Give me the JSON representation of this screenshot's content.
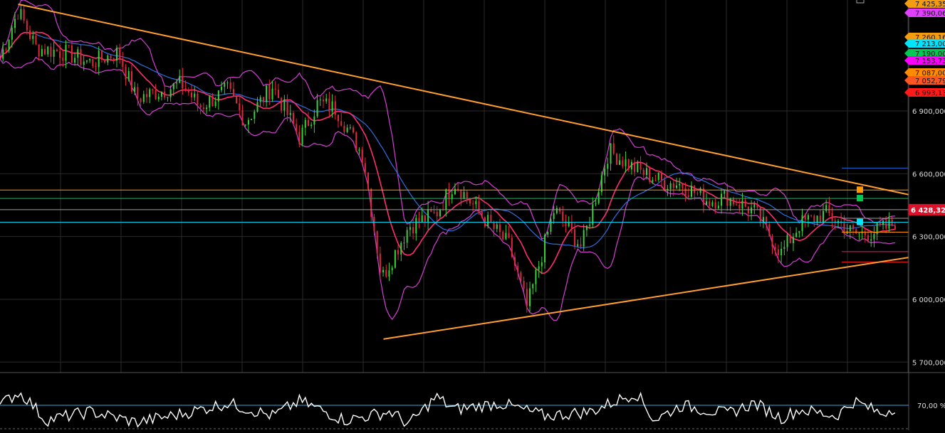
{
  "chart_data": [
    {
      "type": "candlestick",
      "title": "",
      "xlabel": "",
      "ylabel": "",
      "ylim": [
        5650000,
        7430000
      ],
      "grid": true,
      "y_tick_labels": [
        "6 900,000",
        "6 600,000",
        "6 300,000",
        "6 000,000",
        "5 700,000"
      ],
      "y_tick_values": [
        6900000,
        6600000,
        6300000,
        6000000,
        5700000
      ],
      "current_price_label": "6 428,320",
      "current_price": 6428320,
      "price_tags": [
        {
          "label": "7 425,356",
          "value": 7425356,
          "color": "#f39c12"
        },
        {
          "label": "7 390,06",
          "value": 7390060,
          "color": "#e040fb"
        },
        {
          "label": "7 260,160",
          "value": 7260160,
          "color": "#f39c12"
        },
        {
          "label": "7 213,00",
          "value": 7213000,
          "color": "#00e5ff"
        },
        {
          "label": "7 190,00",
          "value": 7190000,
          "color": "#00c853"
        },
        {
          "label": "7 153,73",
          "value": 7153730,
          "color": "#ff00ff"
        },
        {
          "label": "7 087,00",
          "value": 7087000,
          "color": "#ff8c00"
        },
        {
          "label": "7 052,79",
          "value": 7052790,
          "color": "#ff5722"
        },
        {
          "label": "6 993,13",
          "value": 6993130,
          "color": "#ff1a1a"
        }
      ],
      "horizontal_levels": [
        {
          "value": 6522000,
          "color": "#ff9800",
          "marker": true
        },
        {
          "value": 6482000,
          "color": "#00c853",
          "marker": true
        },
        {
          "value": 6428320,
          "color": "#9e9e9e",
          "marker": false
        },
        {
          "value": 6368000,
          "color": "#00e5ff",
          "marker": true
        },
        {
          "value": 6627000,
          "color": "#1e6bd6",
          "marker": false
        },
        {
          "value": 6387000,
          "color": "#9e9e9e",
          "marker": false
        },
        {
          "value": 6321000,
          "color": "#ff9800",
          "marker": false
        },
        {
          "value": 6228000,
          "color": "#e91e63",
          "marker": false
        },
        {
          "value": 6178000,
          "color": "#ff1a1a",
          "marker": false
        }
      ],
      "trendlines": [
        {
          "name": "",
          "from": [
            0.02,
            7410000
          ],
          "to": [
            1.0,
            6500000
          ],
          "color": "#ff9d2e"
        },
        {
          "name": "",
          "from": [
            0.422,
            5810000
          ],
          "to": [
            1.0,
            6200000
          ],
          "color": "#ff9d2e"
        }
      ],
      "series": [
        {
          "name": "",
          "kind": "close",
          "x": [
            0,
            0.02,
            0.04,
            0.07,
            0.1,
            0.13,
            0.15,
            0.18,
            0.2,
            0.22,
            0.25,
            0.27,
            0.3,
            0.33,
            0.35,
            0.37,
            0.4,
            0.42,
            0.45,
            0.48,
            0.5,
            0.53,
            0.56,
            0.58,
            0.61,
            0.64,
            0.67,
            0.7,
            0.73,
            0.75,
            0.78,
            0.8,
            0.83,
            0.86,
            0.88,
            0.91,
            0.94,
            0.96,
            0.98,
            1.0
          ],
          "values": [
            7150000,
            7380000,
            7200000,
            7180000,
            7130000,
            7180000,
            6960000,
            7000000,
            7030000,
            6920000,
            7000000,
            6850000,
            7020000,
            6770000,
            6940000,
            6910000,
            6680000,
            6100000,
            6350000,
            6410000,
            6560000,
            6400000,
            6260000,
            5960000,
            6430000,
            6250000,
            6710000,
            6620000,
            6560000,
            6550000,
            6470000,
            6490000,
            6420000,
            6220000,
            6360000,
            6410000,
            6310000,
            6320000,
            6350000,
            6428320
          ]
        }
      ]
    },
    {
      "type": "line",
      "title": "",
      "ylabel": "",
      "ylim": [
        0,
        100
      ],
      "threshold_label": "70,00 %",
      "threshold": 70,
      "series": [
        {
          "name": "",
          "x": [
            0,
            0.02,
            0.03,
            0.05,
            0.1,
            0.15,
            0.2,
            0.25,
            0.3,
            0.33,
            0.38,
            0.43,
            0.45,
            0.48,
            0.5,
            0.55,
            0.6,
            0.65,
            0.7,
            0.72,
            0.75,
            0.8,
            0.83,
            0.86,
            0.88,
            0.92,
            0.94,
            0.97,
            1.0
          ],
          "values": [
            55,
            85,
            70,
            20,
            40,
            15,
            35,
            60,
            30,
            65,
            20,
            40,
            10,
            75,
            45,
            60,
            30,
            40,
            85,
            20,
            55,
            35,
            60,
            25,
            45,
            30,
            65,
            35,
            68
          ]
        }
      ]
    }
  ]
}
